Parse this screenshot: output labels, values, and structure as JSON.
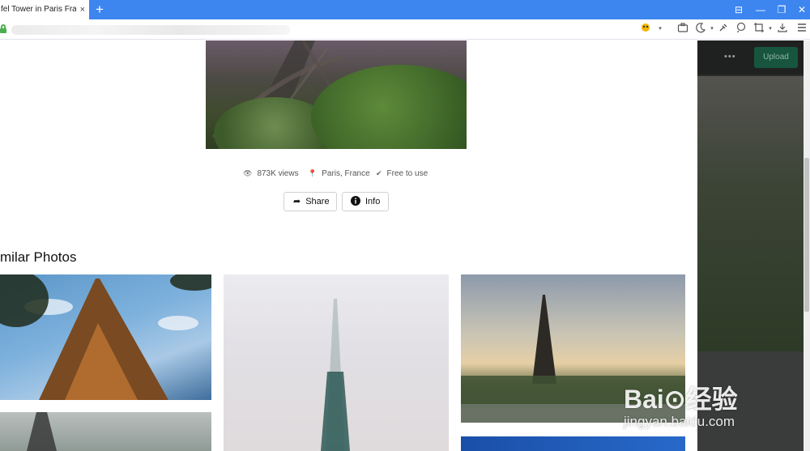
{
  "browser": {
    "tab_title": "fel Tower in Paris Frar",
    "tab_close": "×",
    "new_tab": "+",
    "window_controls": [
      "⊟",
      "—",
      "❐",
      "✕"
    ]
  },
  "photo": {
    "meta": {
      "views": "873K views",
      "location": "Paris, France",
      "license": "Free to use"
    },
    "actions": {
      "share_label": "Share",
      "info_label": "Info"
    }
  },
  "similar": {
    "title": "milar Photos"
  },
  "background_page": {
    "dots": "•••",
    "upload_label": "Upload"
  },
  "watermark": {
    "brand": "Bai⊙经验",
    "url": "jingyan.baidu.com"
  }
}
